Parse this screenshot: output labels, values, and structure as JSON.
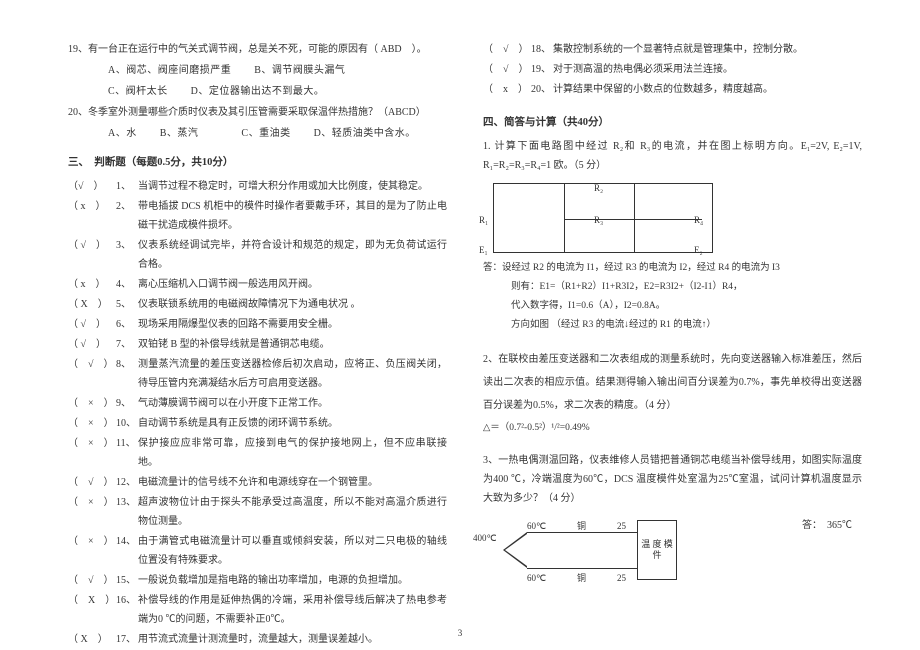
{
  "left": {
    "q19": {
      "stem": "19、有一台正在运行中的气关式调节阀，总是关不死，可能的原因有（ ABD　）。",
      "a": "A、阀芯、阀座间磨损严重",
      "b": "B、调节阀膜头漏气",
      "c": "C、阀杆太长",
      "d": "D、定位器输出达不到最大。"
    },
    "q20": {
      "stem": "20、冬季室外测量哪些介质时仪表及其引压管需要采取保温伴热措施？（ABCD）",
      "a": "A、水",
      "b": "B、蒸汽",
      "c": "C、重油类",
      "d": "D、轻质油类中含水。"
    },
    "section3": "三、　判断题（每题0.5分，共10分）",
    "j": [
      {
        "mark": "（√　）",
        "num": "1、",
        "text": "当调节过程不稳定时，可增大积分作用或加大比例度，使其稳定。"
      },
      {
        "mark": "（ x　）",
        "num": "2、",
        "text": "带电插拔 DCS 机柜中的模件时操作者要戴手环，其目的是为了防止电磁干扰造成模件损坏。"
      },
      {
        "mark": "（ √　）",
        "num": "3、",
        "text": "仪表系统经调试完毕，并符合设计和规范的规定，即为无负荷试运行合格。"
      },
      {
        "mark": "（ x　）",
        "num": "4、",
        "text": "离心压缩机入口调节阀一般选用风开阀。"
      },
      {
        "mark": "（ X　）",
        "num": "5、",
        "text": "仪表联锁系统用的电磁阀故障情况下为通电状况 。"
      },
      {
        "mark": "（ √　）",
        "num": "6、",
        "text": "现场采用隔爆型仪表的回路不需要用安全栅。"
      },
      {
        "mark": "（ √　）",
        "num": "7、",
        "text": "双铂铑 B 型的补偿导线就是普通铜芯电缆。"
      },
      {
        "mark": "（　√　）",
        "num": "8、",
        "text": "测量蒸汽流量的差压变送器检修后初次启动，应将正、负压阀关闭，待导压管内充满凝结水后方可启用变送器。"
      },
      {
        "mark": "（　×　）",
        "num": "9、",
        "text": "气动薄膜调节阀可以在小开度下正常工作。"
      },
      {
        "mark": "（　×　）",
        "num": "10、",
        "text": "自动调节系统是具有正反馈的闭环调节系统。"
      },
      {
        "mark": "（　×　）",
        "num": "11、",
        "text": "保护接应应非常可靠，应接到电气的保护接地网上，但不应串联接地。"
      },
      {
        "mark": "（　√　）",
        "num": "12、",
        "text": "电磁流量计的信号线不允许和电源线穿在一个钢管里。"
      },
      {
        "mark": "（　×　）",
        "num": "13、",
        "text": "超声波物位计由于探头不能承受过高温度，所以不能对高温介质进行物位测量。"
      },
      {
        "mark": "（　×　）",
        "num": "14、",
        "text": "由于满管式电磁流量计可以垂直或倾斜安装，所以对二只电极的轴线位置没有特殊要求。"
      },
      {
        "mark": "（　√　）",
        "num": "15、",
        "text": "一般说负载增加是指电路的输出功率增加，电源的负担增加。"
      },
      {
        "mark": "（　X　）",
        "num": "16、",
        "text": "补偿导线的作用是延伸热偶的冷端，采用补偿导线后解决了热电参考端为0 ℃的问题，不需要补正0℃。"
      },
      {
        "mark": "（ X　）",
        "num": "17、",
        "text": "用节流式流量计测流量时，流量越大，测量误差越小。"
      }
    ]
  },
  "right": {
    "jr": [
      {
        "mark": "（　√　）",
        "num": "18、",
        "text": "集散控制系统的一个显著特点就是管理集中，控制分散。"
      },
      {
        "mark": "（　√　）",
        "num": "19、",
        "text": "对于测高温的热电偶必须采用法兰连接。"
      },
      {
        "mark": "（　x　）",
        "num": "20、",
        "text": "计算结果中保留的小数点的位数越多，精度越高。"
      }
    ],
    "section4": "四、简答与计算（共40分）",
    "c1": {
      "stem": "1. 计算下面电路图中经过 R₂和 R₃的电流，并在图上标明方向。E₁=2V, E₂=1V, R₁=R₂=R₃=R₄=1 欧。（5 分）",
      "r1": "R₁",
      "r2": "R₂",
      "r3": "R₃",
      "r4": "R₄",
      "e1": "E₁",
      "e2": "E₂",
      "ans1": "答：设经过 R2 的电流为 I1，经过 R3 的电流为 I2，经过 R4 的电流为 I3",
      "ans2": "则有：E1=（R1+R2）I1+R3I2，E2=R3I2+（I2-I1）R4，",
      "ans3": "代入数字得，I1=0.6（A），I2=0.8A。",
      "ans4": "方向如图 （经过 R3 的电流↓经过的 R1 的电流↑）"
    },
    "c2": {
      "stem": "2、在联校由差压变送器和二次表组成的测量系统时，先向变送器输入标准差压，然后读出二次表的相应示值。结果测得输入输出间百分误差为0.7%，事先单校得出变送器百分误差为0.5%，求二次表的精度。（4 分）",
      "ans": "△＝（0.7²-0.5²）¹/²=0.49%"
    },
    "c3": {
      "stem": "3、一热电偶测温回路，仪表维修人员错把普通铜芯电缆当补偿导线用，如图实际温度为400 ℃，冷端温度为60℃，DCS 温度模件处室温为25℃室温，试问计算机温度显示大致为多少？（4 分）",
      "l60a": "60℃",
      "copper": "铜",
      "l25a": "25",
      "l400": "400℃",
      "l60b": "60℃",
      "copper2": "铜",
      "l25b": "25",
      "module": "温 度 模 件",
      "ans": "答：　365℃"
    }
  },
  "pageNum": "3"
}
